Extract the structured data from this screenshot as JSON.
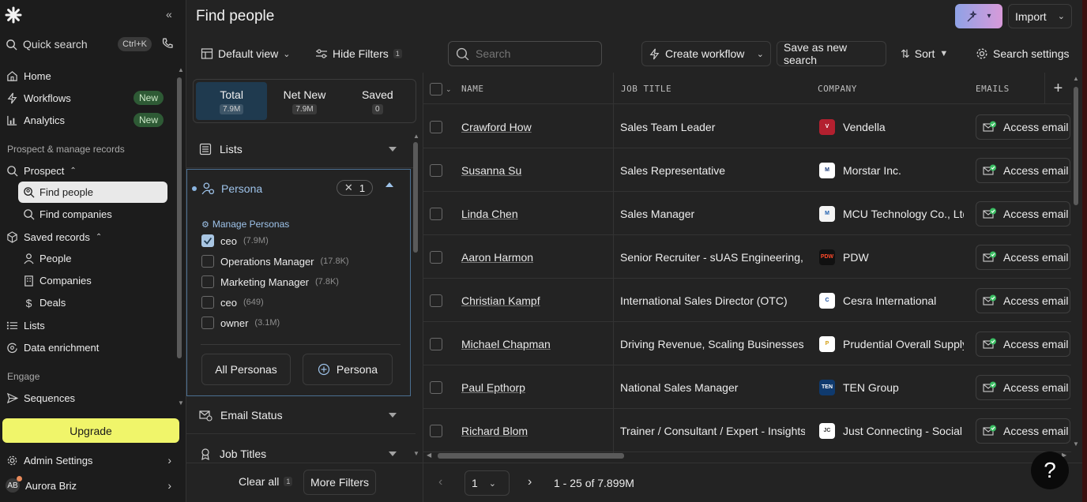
{
  "sidebar": {
    "quick_search": "Quick search",
    "shortcut": "Ctrl+K",
    "nav": [
      {
        "label": "Home",
        "badge": ""
      },
      {
        "label": "Workflows",
        "badge": "New"
      },
      {
        "label": "Analytics",
        "badge": "New"
      }
    ],
    "section_prospect": "Prospect & manage records",
    "prospect": "Prospect",
    "find_people": "Find people",
    "find_companies": "Find companies",
    "saved_records": "Saved records",
    "people": "People",
    "companies": "Companies",
    "deals": "Deals",
    "lists": "Lists",
    "data_enrichment": "Data enrichment",
    "section_engage": "Engage",
    "sequences": "Sequences",
    "upgrade": "Upgrade",
    "admin_settings": "Admin Settings",
    "user_initials": "AB",
    "user_name": "Aurora Briz"
  },
  "header": {
    "title": "Find people",
    "import": "Import",
    "default_view": "Default view",
    "hide_filters": "Hide Filters",
    "hide_filters_count": "1",
    "search_placeholder": "Search",
    "create_workflow": "Create workflow",
    "save_search": "Save as new search",
    "sort": "Sort",
    "search_settings": "Search settings"
  },
  "filters": {
    "tabs": [
      {
        "label": "Total",
        "count": "7.9M"
      },
      {
        "label": "Net New",
        "count": "7.9M"
      },
      {
        "label": "Saved",
        "count": "0"
      }
    ],
    "lists": "Lists",
    "persona": "Persona",
    "persona_count": "1",
    "manage_personas": "Manage Personas",
    "persona_items": [
      {
        "label": "ceo",
        "count": "(7.9M)",
        "checked": true
      },
      {
        "label": "Operations Manager",
        "count": "(17.8K)",
        "checked": false
      },
      {
        "label": "Marketing Manager",
        "count": "(7.8K)",
        "checked": false
      },
      {
        "label": "ceo",
        "count": "(649)",
        "checked": false
      },
      {
        "label": "owner",
        "count": "(3.1M)",
        "checked": false
      }
    ],
    "all_personas": "All Personas",
    "add_persona": "Persona",
    "email_status": "Email Status",
    "job_titles": "Job Titles",
    "clear_all": "Clear all",
    "clear_count": "1",
    "more_filters": "More Filters"
  },
  "table": {
    "columns": [
      "NAME",
      "JOB TITLE",
      "COMPANY",
      "EMAILS"
    ],
    "access_label": "Access email",
    "rows": [
      {
        "name": "Crawford How",
        "title": "Sales Team Leader",
        "company": "Vendella",
        "logo_bg": "#b3202f",
        "logo_fg": "#ffffff",
        "logo_text": "V"
      },
      {
        "name": "Susanna Su",
        "title": "Sales Representative",
        "company": "Morstar Inc.",
        "logo_bg": "#ffffff",
        "logo_fg": "#1a3a7a",
        "logo_text": "M"
      },
      {
        "name": "Linda Chen",
        "title": "Sales Manager",
        "company": "MCU Technology Co., Ltd",
        "logo_bg": "#f4f4f4",
        "logo_fg": "#2060b0",
        "logo_text": "M"
      },
      {
        "name": "Aaron Harmon",
        "title": "Senior Recruiter - sUAS Engineering, I",
        "company": "PDW",
        "logo_bg": "#111111",
        "logo_fg": "#ff4a2a",
        "logo_text": "PDW"
      },
      {
        "name": "Christian Kampf",
        "title": "International Sales Director (OTC)",
        "company": "Cesra International",
        "logo_bg": "#ffffff",
        "logo_fg": "#1a4fa0",
        "logo_text": "C"
      },
      {
        "name": "Michael Chapman",
        "title": "Driving Revenue, Scaling Businesses &",
        "company": "Prudential Overall Supply",
        "logo_bg": "#ffffff",
        "logo_fg": "#d4a017",
        "logo_text": "P"
      },
      {
        "name": "Paul Epthorp",
        "title": "National Sales Manager",
        "company": "TEN Group",
        "logo_bg": "#0f3a6e",
        "logo_fg": "#ffffff",
        "logo_text": "TEN"
      },
      {
        "name": "Richard Blom",
        "title": "Trainer / Consultant / Expert - Insights",
        "company": "Just Connecting - Social",
        "logo_bg": "#ffffff",
        "logo_fg": "#333333",
        "logo_text": "JC"
      }
    ]
  },
  "pagination": {
    "page": "1",
    "range": "1 - 25 of 7.899M"
  },
  "help": "?"
}
